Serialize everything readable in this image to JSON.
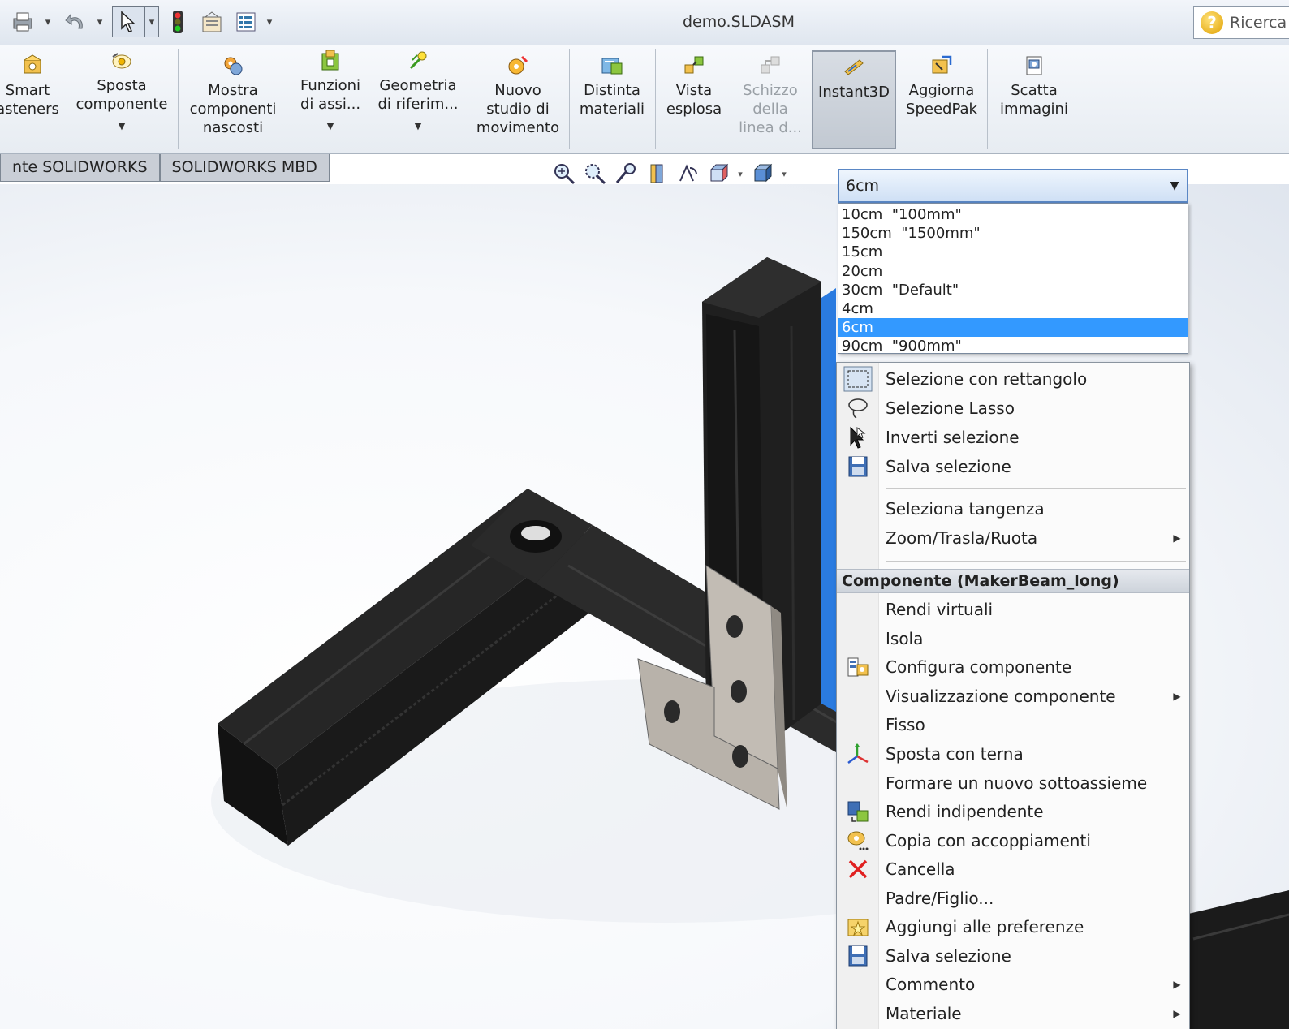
{
  "window": {
    "title": "demo.SLDASM",
    "search_label": "Ricerca"
  },
  "ribbon": {
    "buttons": [
      {
        "label": "Smart\nasteners"
      },
      {
        "label": "Sposta\ncomponente"
      },
      {
        "label": "Mostra\ncomponenti\nnascosti"
      },
      {
        "label": "Funzioni\ndi assi..."
      },
      {
        "label": "Geometria\ndi riferim..."
      },
      {
        "label": "Nuovo\nstudio di\nmovimento"
      },
      {
        "label": "Distinta\nmateriali"
      },
      {
        "label": "Vista\nesplosa"
      },
      {
        "label": "Schizzo\ndella\nlinea d...",
        "disabled": true
      },
      {
        "label": "Instant3D",
        "active": true
      },
      {
        "label": "Aggiorna\nSpeedPak"
      },
      {
        "label": "Scatta\nimmagini"
      }
    ]
  },
  "tabs": [
    "nte SOLIDWORKS",
    "SOLIDWORKS MBD"
  ],
  "configuration": {
    "selected": "6cm",
    "options": [
      "10cm  \"100mm\"",
      "150cm  \"1500mm\"",
      "15cm",
      "20cm",
      "30cm  \"Default\"",
      "4cm",
      "6cm",
      "90cm  \"900mm\""
    ]
  },
  "context_menu": {
    "section1": [
      {
        "label": "Selezione con rettangolo",
        "icon": "box-select-icon"
      },
      {
        "label": "Selezione Lasso",
        "icon": "lasso-icon"
      },
      {
        "label": "Inverti selezione",
        "icon": "invert-selection-icon"
      },
      {
        "label": "Salva selezione",
        "icon": "save-selection-icon"
      }
    ],
    "section2": [
      {
        "label": "Seleziona tangenza"
      },
      {
        "label": "Zoom/Trasla/Ruota",
        "submenu": true
      }
    ],
    "header": "Componente (MakerBeam_long)",
    "section3": [
      {
        "label": "Rendi virtuali"
      },
      {
        "label": "Isola"
      },
      {
        "label": "Configura componente",
        "icon": "configure-icon"
      },
      {
        "label": "Visualizzazione componente",
        "submenu": true
      },
      {
        "label": "Fisso"
      },
      {
        "label": "Sposta con terna",
        "icon": "triad-icon"
      },
      {
        "label": "Formare un nuovo sottoassieme"
      },
      {
        "label": "Rendi indipendente",
        "icon": "make-independent-icon"
      },
      {
        "label": "Copia con accoppiamenti",
        "icon": "copy-mates-icon"
      },
      {
        "label": "Cancella",
        "icon": "delete-icon"
      },
      {
        "label": "Padre/Figlio..."
      },
      {
        "label": "Aggiungi alle preferenze",
        "icon": "favorite-icon"
      },
      {
        "label": "Salva selezione",
        "icon": "save-selection-icon"
      },
      {
        "label": "Commento",
        "submenu": true
      },
      {
        "label": "Materiale",
        "submenu": true
      }
    ]
  },
  "colors": {
    "selection": "#3399ff",
    "beam": "#1c1c1c",
    "bracket": "#b8b2aa"
  }
}
